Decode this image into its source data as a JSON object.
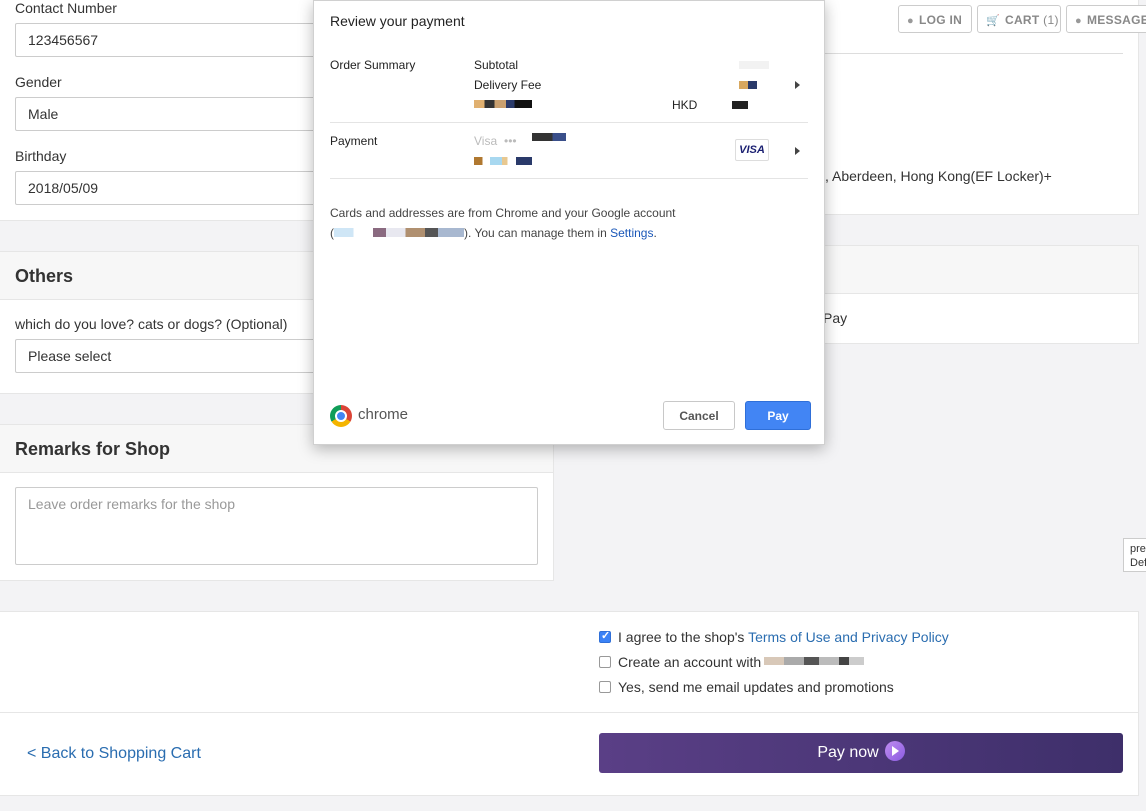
{
  "form": {
    "contact_label": "Contact Number",
    "contact_value": "123456567",
    "gender_label": "Gender",
    "gender_value": "Male",
    "birthday_label": "Birthday",
    "birthday_value": "2018/05/09",
    "others_title": "Others",
    "pet_question": "which do you love? cats or dogs? (Optional)",
    "pet_select": "Please select",
    "remarks_title": "Remarks for Shop",
    "remarks_placeholder": "Leave order remarks for the shop"
  },
  "topbar": {
    "login": "LOG IN",
    "cart": "CART",
    "cart_count": "(1)",
    "message": "MESSAGE"
  },
  "right": {
    "address_text": "x, Aberdeen, Hong Kong(EF Locker)+",
    "pay_text": "Pay"
  },
  "dialog": {
    "title": "Review your payment",
    "order_summary": "Order Summary",
    "subtotal": "Subtotal",
    "delivery_fee": "Delivery Fee",
    "currency": "HKD",
    "payment": "Payment",
    "card_brand": "Visa",
    "card_dots": "•••",
    "visa_logo": "VISA",
    "note_line1": "Cards and addresses are from Chrome and your Google account",
    "note_line2_pre": "(",
    "note_line2_post": "). You can manage them in ",
    "settings_link": "Settings",
    "note_line2_end": ".",
    "chrome_word": "chrome",
    "cancel": "Cancel",
    "pay": "Pay"
  },
  "agreements": {
    "terms_prefix": "I agree to the shop's ",
    "terms_link": "Terms of Use and Privacy Policy",
    "terms_checked": true,
    "account_label": "Create an account with",
    "account_checked": false,
    "email_label": "Yes, send me email updates and promotions",
    "email_checked": false
  },
  "footer": {
    "back_link": "< Back to Shopping Cart",
    "pay_now": "Pay now"
  },
  "tooltip": {
    "line1": "pre",
    "line2": "Def"
  },
  "colors": {
    "accent_blue": "#4285f4",
    "link_blue": "#2a6db0",
    "pay_now_purple": "#4b3678"
  }
}
